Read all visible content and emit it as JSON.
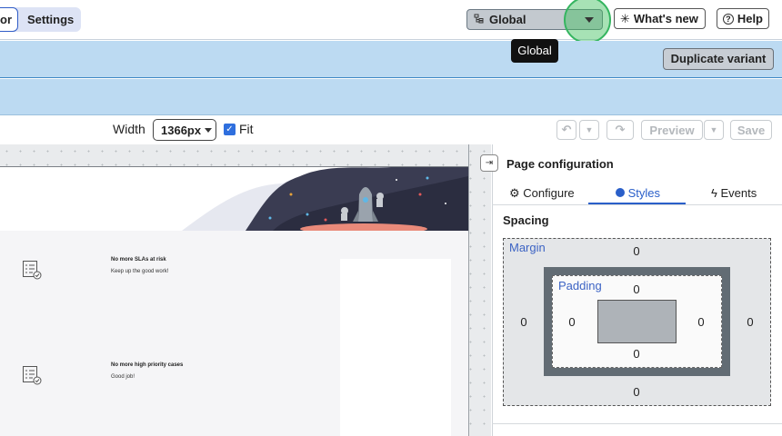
{
  "header": {
    "segmented": {
      "left_label": "or",
      "right_label": "Settings"
    },
    "global_button": {
      "label": "Global"
    },
    "whats_new_label": "What's new",
    "help_label": "Help",
    "tooltip": "Global"
  },
  "banner": {
    "duplicate_label": "Duplicate variant"
  },
  "toolbar": {
    "width_label": "Width",
    "width_value": "1366px",
    "fit_label": "Fit",
    "preview_label": "Preview",
    "save_label": "Save"
  },
  "canvas": {
    "items": [
      {
        "title": "No more SLAs at risk",
        "subtitle": "Keep up the good work!"
      },
      {
        "title": "No more high priority cases",
        "subtitle": "Good job!"
      }
    ]
  },
  "panel": {
    "title": "Page configuration",
    "tabs": [
      {
        "label": "Configure",
        "icon": "gear-icon",
        "active": false
      },
      {
        "label": "Styles",
        "icon": "palette-icon",
        "active": true
      },
      {
        "label": "Events",
        "icon": "bolt-icon",
        "active": false
      }
    ],
    "section": "Spacing",
    "box_model": {
      "margin_label": "Margin",
      "padding_label": "Padding",
      "margin": {
        "top": "0",
        "right": "0",
        "bottom": "0",
        "left": "0"
      },
      "padding": {
        "top": "0",
        "right": "0",
        "bottom": "0",
        "left": "0"
      }
    }
  },
  "colors": {
    "accent": "#2a5fc9",
    "band": "#bcdaf2",
    "highlight": "#35b560"
  }
}
